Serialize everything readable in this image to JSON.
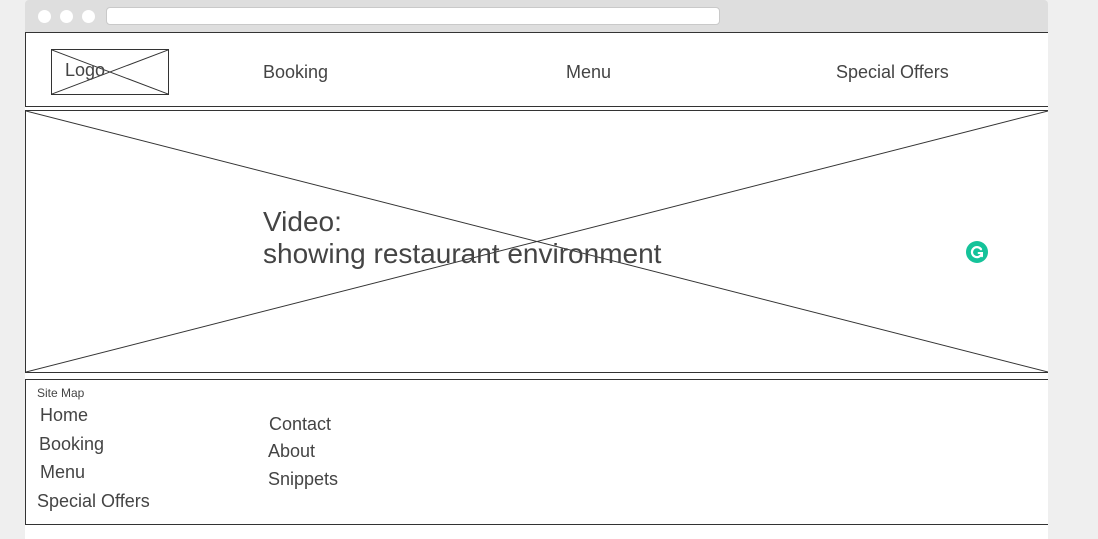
{
  "header": {
    "logo_label": "Logo",
    "nav": [
      "Booking",
      "Menu",
      "Special Offers"
    ]
  },
  "hero": {
    "line1": "Video:",
    "line2": "showing restaurant environment"
  },
  "footer": {
    "title": "Site Map",
    "col1": [
      "Home",
      "Booking",
      "Menu",
      "Special Offers"
    ],
    "col2": [
      "Contact",
      "About",
      "Snippets"
    ]
  },
  "colors": {
    "grammarly": "#15c39a"
  }
}
